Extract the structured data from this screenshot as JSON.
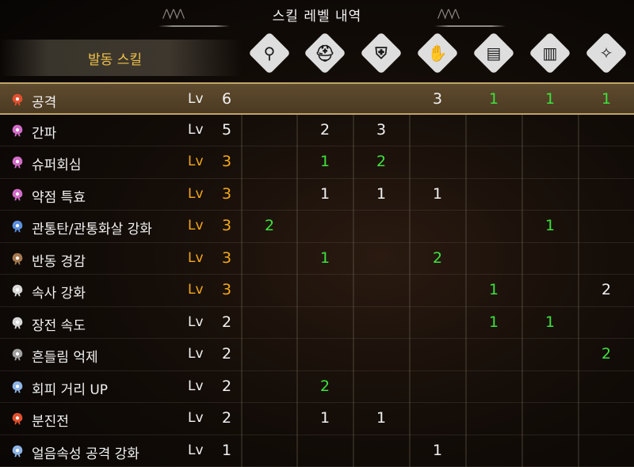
{
  "title": "스킬 레벨 내역",
  "deco_left": "⋀⋀⋀",
  "deco_right": "⋀⋀⋀",
  "header_label": "발동 스킬",
  "equipment": [
    {
      "icon": "weapon-icon",
      "glyph": "⚲"
    },
    {
      "icon": "helm-icon",
      "glyph": "⛑"
    },
    {
      "icon": "chest-icon",
      "glyph": "⛨"
    },
    {
      "icon": "arms-icon",
      "glyph": "✋"
    },
    {
      "icon": "waist-icon",
      "glyph": "▤"
    },
    {
      "icon": "legs-icon",
      "glyph": "▥"
    },
    {
      "icon": "charm-icon",
      "glyph": "✧"
    }
  ],
  "colors": {
    "highlight": "#4b3a22",
    "gold": "#f3a81c",
    "green": "#3ee23e"
  },
  "skills": [
    {
      "name": "공격",
      "lv": "Lv",
      "level": "6",
      "color": "#e2502e",
      "gold": false,
      "hl": true,
      "values": [
        {
          "v": "",
          "c": "w"
        },
        {
          "v": "",
          "c": "w"
        },
        {
          "v": "",
          "c": "w"
        },
        {
          "v": "3",
          "c": "w"
        },
        {
          "v": "1",
          "c": "g"
        },
        {
          "v": "1",
          "c": "g"
        },
        {
          "v": "1",
          "c": "g"
        }
      ]
    },
    {
      "name": "간파",
      "lv": "Lv",
      "level": "5",
      "color": "#d26bc7",
      "gold": false,
      "hl": false,
      "values": [
        {
          "v": "",
          "c": "w"
        },
        {
          "v": "2",
          "c": "w"
        },
        {
          "v": "3",
          "c": "w"
        },
        {
          "v": "",
          "c": "w"
        },
        {
          "v": "",
          "c": "w"
        },
        {
          "v": "",
          "c": "w"
        },
        {
          "v": "",
          "c": "w"
        }
      ]
    },
    {
      "name": "슈퍼회심",
      "lv": "Lv",
      "level": "3",
      "color": "#d26bc7",
      "gold": true,
      "hl": false,
      "values": [
        {
          "v": "",
          "c": "w"
        },
        {
          "v": "1",
          "c": "g"
        },
        {
          "v": "2",
          "c": "g"
        },
        {
          "v": "",
          "c": "w"
        },
        {
          "v": "",
          "c": "w"
        },
        {
          "v": "",
          "c": "w"
        },
        {
          "v": "",
          "c": "w"
        }
      ]
    },
    {
      "name": "약점 특효",
      "lv": "Lv",
      "level": "3",
      "color": "#d26bc7",
      "gold": true,
      "hl": false,
      "values": [
        {
          "v": "",
          "c": "w"
        },
        {
          "v": "1",
          "c": "w"
        },
        {
          "v": "1",
          "c": "w"
        },
        {
          "v": "1",
          "c": "w"
        },
        {
          "v": "",
          "c": "w"
        },
        {
          "v": "",
          "c": "w"
        },
        {
          "v": "",
          "c": "w"
        }
      ]
    },
    {
      "name": "관통탄/관통화살 강화",
      "lv": "Lv",
      "level": "3",
      "color": "#5b8fdc",
      "gold": true,
      "hl": false,
      "values": [
        {
          "v": "2",
          "c": "g"
        },
        {
          "v": "",
          "c": "w"
        },
        {
          "v": "",
          "c": "w"
        },
        {
          "v": "",
          "c": "w"
        },
        {
          "v": "",
          "c": "w"
        },
        {
          "v": "1",
          "c": "g"
        },
        {
          "v": "",
          "c": "w"
        }
      ]
    },
    {
      "name": "반동 경감",
      "lv": "Lv",
      "level": "3",
      "color": "#a5794f",
      "gold": true,
      "hl": false,
      "values": [
        {
          "v": "",
          "c": "w"
        },
        {
          "v": "1",
          "c": "g"
        },
        {
          "v": "",
          "c": "w"
        },
        {
          "v": "2",
          "c": "g"
        },
        {
          "v": "",
          "c": "w"
        },
        {
          "v": "",
          "c": "w"
        },
        {
          "v": "",
          "c": "w"
        }
      ]
    },
    {
      "name": "속사 강화",
      "lv": "Lv",
      "level": "3",
      "color": "#d8d8d8",
      "gold": true,
      "hl": false,
      "values": [
        {
          "v": "",
          "c": "w"
        },
        {
          "v": "",
          "c": "w"
        },
        {
          "v": "",
          "c": "w"
        },
        {
          "v": "",
          "c": "w"
        },
        {
          "v": "1",
          "c": "g"
        },
        {
          "v": "",
          "c": "w"
        },
        {
          "v": "2",
          "c": "w"
        }
      ]
    },
    {
      "name": "장전 속도",
      "lv": "Lv",
      "level": "2",
      "color": "#d8d8d8",
      "gold": false,
      "hl": false,
      "values": [
        {
          "v": "",
          "c": "w"
        },
        {
          "v": "",
          "c": "w"
        },
        {
          "v": "",
          "c": "w"
        },
        {
          "v": "",
          "c": "w"
        },
        {
          "v": "1",
          "c": "g"
        },
        {
          "v": "1",
          "c": "g"
        },
        {
          "v": "",
          "c": "w"
        }
      ]
    },
    {
      "name": "흔들림 억제",
      "lv": "Lv",
      "level": "2",
      "color": "#a0a0a0",
      "gold": false,
      "hl": false,
      "values": [
        {
          "v": "",
          "c": "w"
        },
        {
          "v": "",
          "c": "w"
        },
        {
          "v": "",
          "c": "w"
        },
        {
          "v": "",
          "c": "w"
        },
        {
          "v": "",
          "c": "w"
        },
        {
          "v": "",
          "c": "w"
        },
        {
          "v": "2",
          "c": "g"
        }
      ]
    },
    {
      "name": "회피 거리 UP",
      "lv": "Lv",
      "level": "2",
      "color": "#8fb4e6",
      "gold": false,
      "hl": false,
      "values": [
        {
          "v": "",
          "c": "w"
        },
        {
          "v": "2",
          "c": "g"
        },
        {
          "v": "",
          "c": "w"
        },
        {
          "v": "",
          "c": "w"
        },
        {
          "v": "",
          "c": "w"
        },
        {
          "v": "",
          "c": "w"
        },
        {
          "v": "",
          "c": "w"
        }
      ]
    },
    {
      "name": "분진전",
      "lv": "Lv",
      "level": "2",
      "color": "#e2502e",
      "gold": false,
      "hl": false,
      "values": [
        {
          "v": "",
          "c": "w"
        },
        {
          "v": "1",
          "c": "w"
        },
        {
          "v": "1",
          "c": "w"
        },
        {
          "v": "",
          "c": "w"
        },
        {
          "v": "",
          "c": "w"
        },
        {
          "v": "",
          "c": "w"
        },
        {
          "v": "",
          "c": "w"
        }
      ]
    },
    {
      "name": "얼음속성 공격 강화",
      "lv": "Lv",
      "level": "1",
      "color": "#8fb4e6",
      "gold": false,
      "hl": false,
      "values": [
        {
          "v": "",
          "c": "w"
        },
        {
          "v": "",
          "c": "w"
        },
        {
          "v": "",
          "c": "w"
        },
        {
          "v": "1",
          "c": "w"
        },
        {
          "v": "",
          "c": "w"
        },
        {
          "v": "",
          "c": "w"
        },
        {
          "v": "",
          "c": "w"
        }
      ]
    }
  ]
}
